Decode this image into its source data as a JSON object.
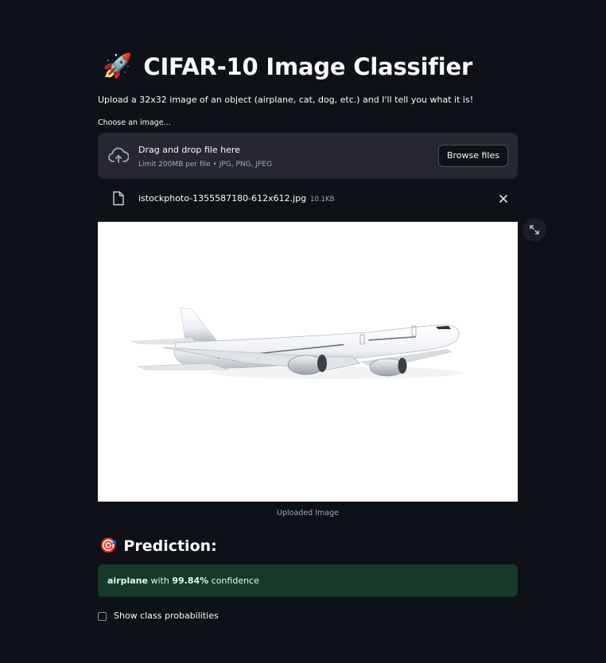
{
  "header": {
    "title_emoji": "🚀",
    "title": "CIFAR-10 Image Classifier",
    "subtitle": "Upload a 32x32 image of an object (airplane, cat, dog, etc.) and I'll tell you what it is!"
  },
  "uploader": {
    "label": "Choose an image...",
    "drop_title": "Drag and drop file here",
    "limit_text": "Limit 200MB per file • JPG, PNG, JPEG",
    "browse_label": "Browse files",
    "file_name": "istockphoto-1355587180-612x612.jpg",
    "file_size": "10.1KB"
  },
  "image": {
    "caption": "Uploaded Image"
  },
  "prediction": {
    "heading_emoji": "🎯",
    "heading": "Prediction:",
    "label": "airplane",
    "with_text": " with ",
    "confidence": "99.84%",
    "confidence_suffix": " confidence"
  },
  "options": {
    "show_probs_label": "Show class probabilities",
    "show_probs_checked": false
  },
  "colors": {
    "background": "#0e1117",
    "surface": "#262730",
    "success_bg": "#173928",
    "success_text": "#dffde9",
    "muted_text": "#a3a8b8"
  }
}
